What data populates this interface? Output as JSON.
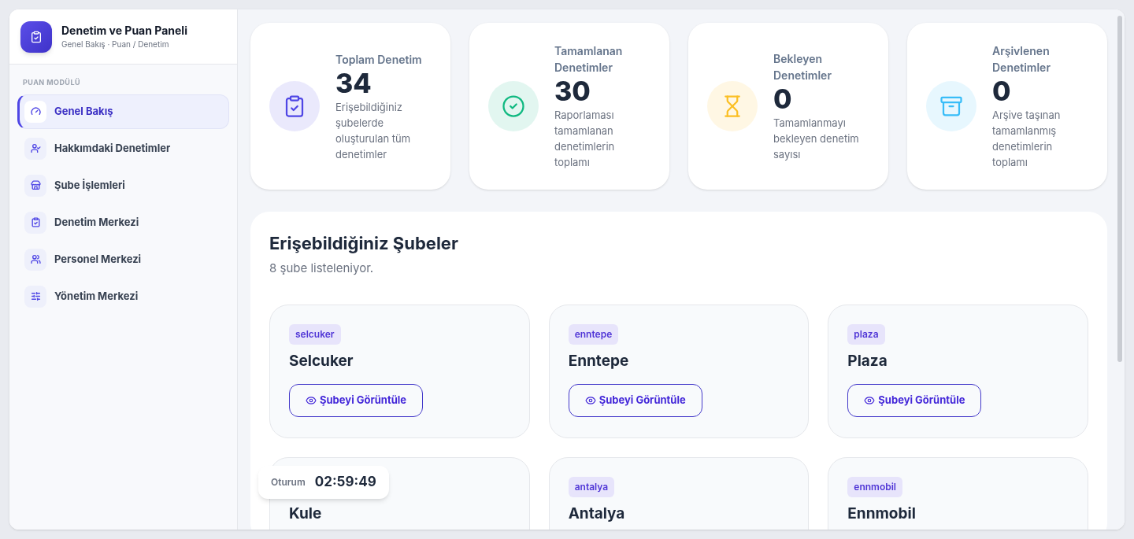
{
  "sidebar": {
    "app_title": "Denetim ve Puan Paneli",
    "app_subtitle": "Genel Bakış · Puan / Denetim",
    "section_label": "PUAN MODÜLÜ",
    "items": [
      {
        "label": "Genel Bakış",
        "selected": true
      },
      {
        "label": "Hakkımdaki Denetimler",
        "selected": false
      },
      {
        "label": "Şube İşlemleri",
        "selected": false
      },
      {
        "label": "Denetim Merkezi",
        "selected": false
      },
      {
        "label": "Personel Merkezi",
        "selected": false
      },
      {
        "label": "Yönetim Merkezi",
        "selected": false
      }
    ]
  },
  "stats": [
    {
      "title": "Toplam Denetim",
      "value": "34",
      "description": "Erişebildiğiniz şubelerde oluşturulan tüm denetimler",
      "color": "#4f46e5"
    },
    {
      "title": "Tamamlanan Denetimler",
      "value": "30",
      "description": "Raporlaması tamamlanan denetimlerin toplamı",
      "color": "#10b981"
    },
    {
      "title": "Bekleyen Denetimler",
      "value": "0",
      "description": "Tamamlanmayı bekleyen denetim sayısı",
      "color": "#fbbf24"
    },
    {
      "title": "Arşivlenen Denetimler",
      "value": "0",
      "description": "Arşive taşınan tamamlanmış denetimlerin toplamı",
      "color": "#38bdf8"
    }
  ],
  "branches_section": {
    "title": "Erişebildiğiniz Şubeler",
    "subtitle": "8 şube listeleniyor.",
    "branches": [
      {
        "code": "selcuker",
        "name": "Selcuker",
        "button": "Şubeyi Görüntüle"
      },
      {
        "code": "enntepe",
        "name": "Enntepe",
        "button": "Şubeyi Görüntüle"
      },
      {
        "code": "plaza",
        "name": "Plaza",
        "button": "Şubeyi Görüntüle"
      },
      {
        "name": "Kule"
      },
      {
        "code": "antalya",
        "name": "Antalya"
      },
      {
        "code": "ennmobil",
        "name": "Ennmobil"
      }
    ]
  },
  "session": {
    "label": "Oturum",
    "time": "02:59:49"
  }
}
